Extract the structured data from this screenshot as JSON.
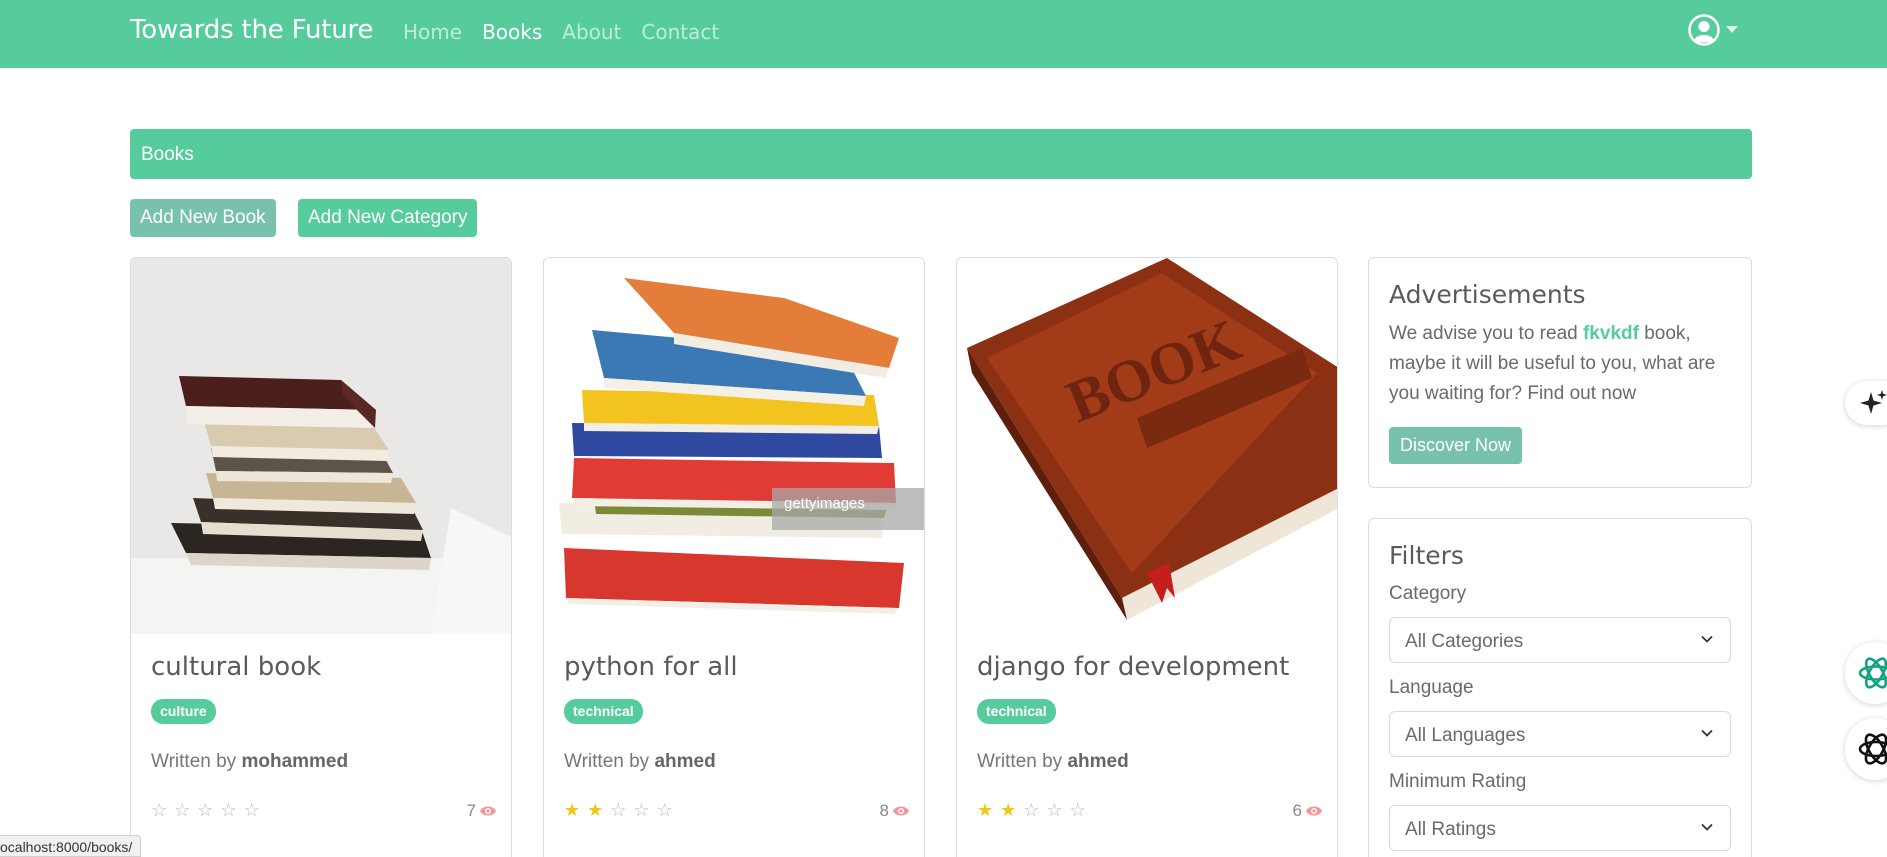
{
  "navbar": {
    "brand": "Towards the Future",
    "links": [
      "Home",
      "Books",
      "About",
      "Contact"
    ],
    "active": "Books",
    "user_icon": "user-circle-icon"
  },
  "page": {
    "header": "Books",
    "add_book_label": "Add New Book",
    "add_category_label": "Add New Category"
  },
  "books": [
    {
      "title": "cultural book",
      "category": "culture",
      "written_by": "Written by",
      "author": "mohammed",
      "rating": 0,
      "views": "7"
    },
    {
      "title": "python for all",
      "category": "technical",
      "written_by": "Written by",
      "author": "ahmed",
      "rating": 2,
      "views": "8"
    },
    {
      "title": "django for development",
      "category": "technical",
      "written_by": "Written by",
      "author": "ahmed",
      "rating": 2,
      "views": "6"
    }
  ],
  "ads": {
    "title": "Advertisements",
    "text_before": "We advise you to read",
    "highlight": "fkvkdf",
    "text_after": "book, maybe it will be useful to you, what are you waiting for? Find out now",
    "button": "Discover Now"
  },
  "filters": {
    "title": "Filters",
    "category_label": "Category",
    "category_value": "All Categories",
    "language_label": "Language",
    "language_value": "All Languages",
    "rating_label": "Minimum Rating",
    "rating_value": "All Ratings"
  },
  "status_bar": "ocalhost:8000/books/",
  "colors": {
    "primary": "#56cc9d",
    "secondary": "#78c2ad",
    "views_icon": "#f3969a",
    "star": "#f0c814"
  }
}
